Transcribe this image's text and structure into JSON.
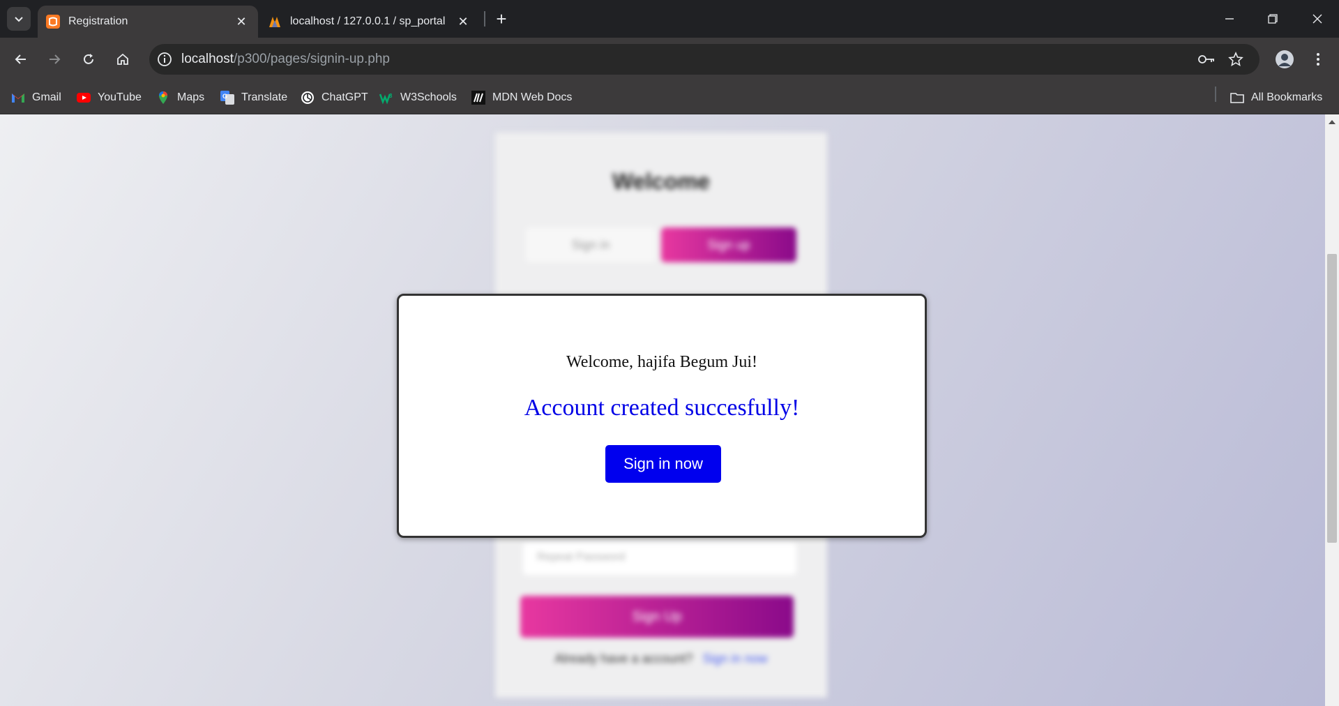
{
  "browser": {
    "tabs": [
      {
        "title": "Registration",
        "favicon": "xampp-icon",
        "active": true
      },
      {
        "title": "localhost / 127.0.0.1 / sp_portal",
        "favicon": "phpmyadmin-icon",
        "active": false
      }
    ],
    "address": {
      "host": "localhost",
      "path": "/p300/pages/signin-up.php"
    },
    "bookmarks": [
      {
        "label": "Gmail",
        "icon": "gmail-icon"
      },
      {
        "label": "YouTube",
        "icon": "youtube-icon"
      },
      {
        "label": "Maps",
        "icon": "maps-icon"
      },
      {
        "label": "Translate",
        "icon": "translate-icon"
      },
      {
        "label": "ChatGPT",
        "icon": "chatgpt-icon"
      },
      {
        "label": "W3Schools",
        "icon": "w3schools-icon"
      },
      {
        "label": "MDN Web Docs",
        "icon": "mdn-icon"
      }
    ],
    "all_bookmarks": "All Bookmarks"
  },
  "page": {
    "form_title": "Welcome",
    "tab_signin": "Sign in",
    "tab_signup": "Sign up",
    "input_placeholder": "Repeat Password",
    "submit": "Sign Up",
    "footer_text": "Already have a account?",
    "footer_link": "Sign in now"
  },
  "modal": {
    "greeting": "Welcome, hajifa Begum Jui!",
    "message": "Account created succesfully!",
    "button": "Sign in now"
  },
  "colors": {
    "accent_blue": "#0000ee",
    "success_text": "#0000e6",
    "gradient_pink": "#e838a0",
    "gradient_purple": "#8a0a8a"
  }
}
